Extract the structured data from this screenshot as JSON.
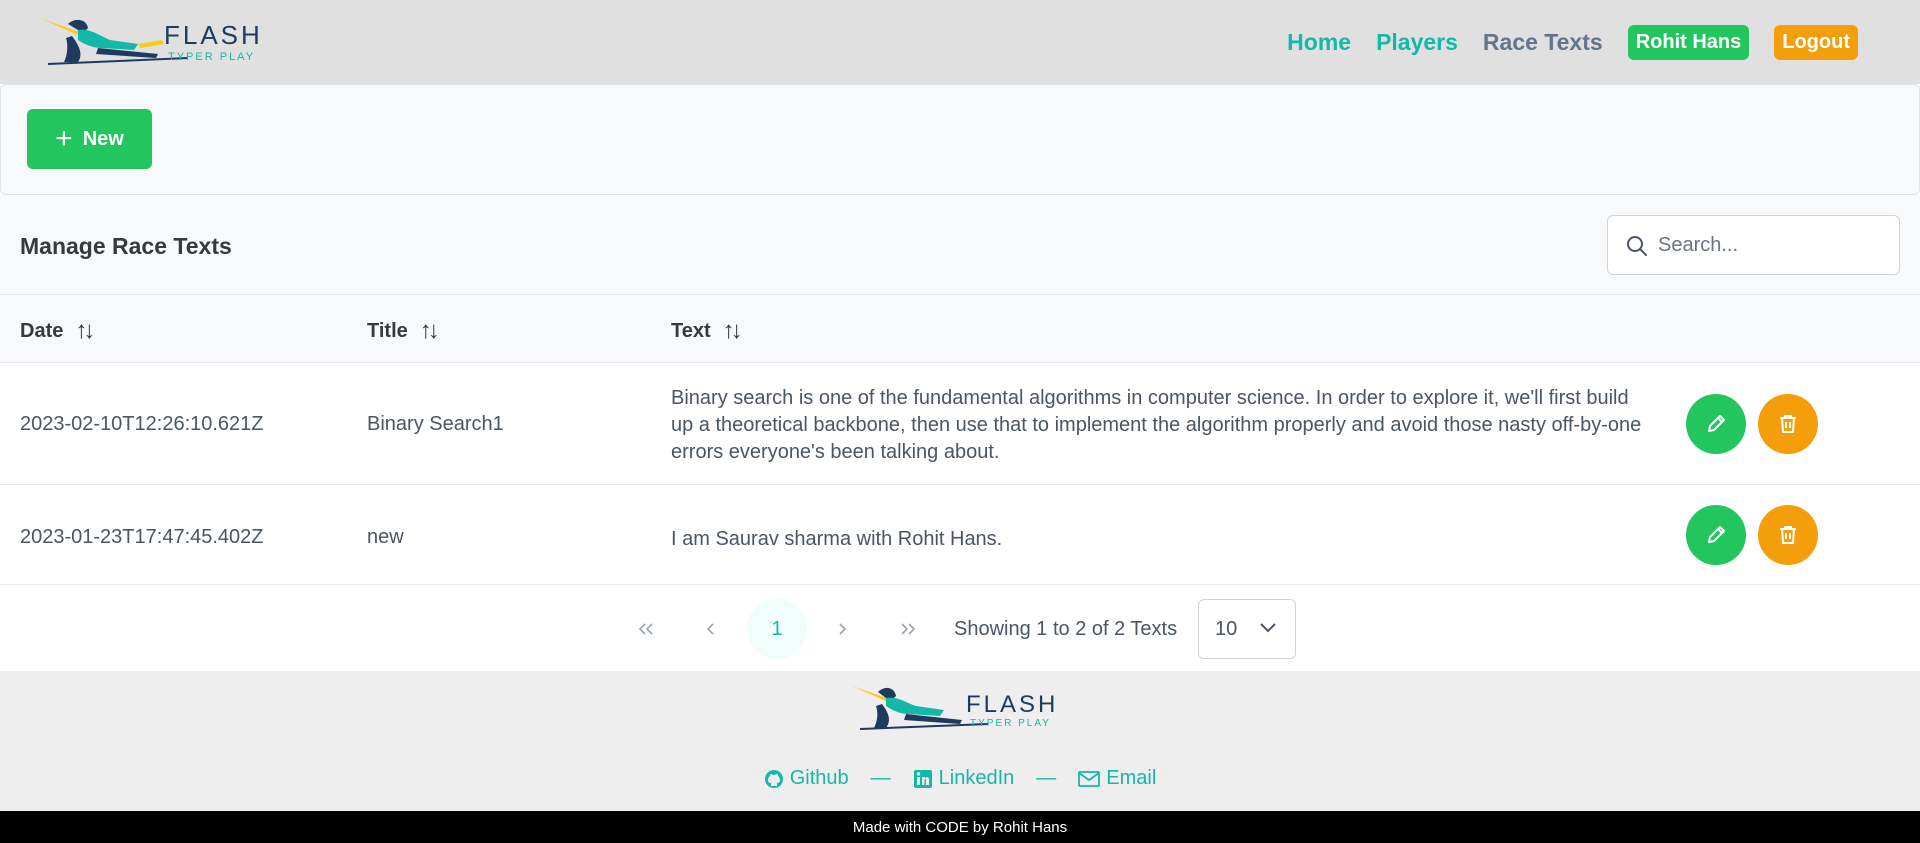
{
  "brand": {
    "name": "FLASH",
    "tagline": "TYPER PLAY"
  },
  "nav": {
    "home": "Home",
    "players": "Players",
    "race_texts": "Race Texts",
    "user": "Rohit Hans",
    "logout": "Logout"
  },
  "toolbar": {
    "new_label": "New"
  },
  "table": {
    "title": "Manage Race Texts",
    "search_placeholder": "Search...",
    "columns": [
      "Date",
      "Title",
      "Text"
    ],
    "rows": [
      {
        "date": "2023-02-10T12:26:10.621Z",
        "title": "Binary Search1",
        "text": "Binary search is one of the fundamental algorithms in computer science. In order to explore it, we'll first build up a theoretical backbone, then use that to implement the algorithm properly and avoid those nasty off-by-one errors everyone's been talking about."
      },
      {
        "date": "2023-01-23T17:47:45.402Z",
        "title": "new",
        "text": "I am Saurav sharma with Rohit Hans."
      }
    ]
  },
  "paginator": {
    "current_page": "1",
    "report": "Showing 1 to 2 of 2 Texts",
    "rows_per_page": "10"
  },
  "footer": {
    "links": [
      "Github",
      "LinkedIn",
      "Email"
    ],
    "separator": "—",
    "credit": "Made with CODE by Rohit Hans"
  },
  "colors": {
    "teal": "#14b8a6",
    "green": "#22c55e",
    "amber": "#f59e0b",
    "navy": "#1e3a5f"
  },
  "icons": [
    "plus-icon",
    "search-icon",
    "sort-icon",
    "pencil-icon",
    "trash-icon",
    "chevron-double-left-icon",
    "chevron-left-icon",
    "chevron-right-icon",
    "chevron-double-right-icon",
    "chevron-down-icon",
    "github-icon",
    "linkedin-icon",
    "envelope-icon"
  ]
}
